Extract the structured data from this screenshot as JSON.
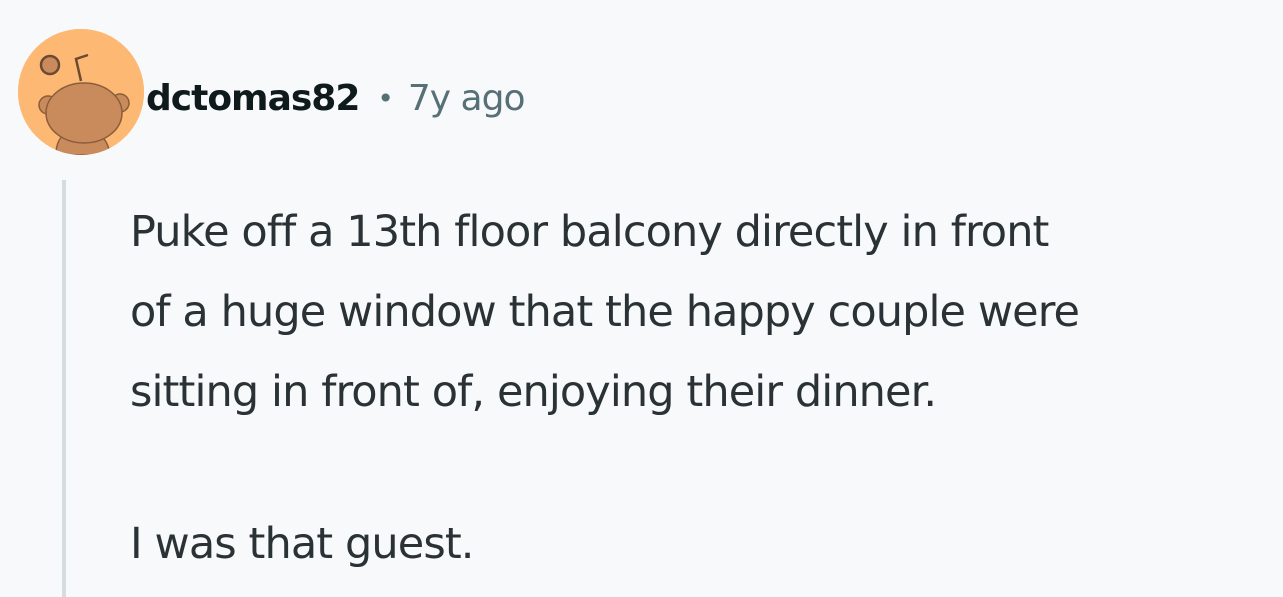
{
  "comment": {
    "author": "dctomas82",
    "separator": "•",
    "time": "7y ago",
    "body_lines": [
      "Puke off a 13th floor balcony directly in front",
      "of a huge window that the happy couple were",
      "sitting in front of, enjoying their dinner."
    ],
    "body_paragraph_2": "I was that guest.",
    "avatar_icon": "snoo-avatar-icon",
    "colors": {
      "avatar_bg": "#fdb974",
      "avatar_figure": "#c98b5c",
      "background": "#f7f9fa",
      "thread_line": "#d6dde1"
    }
  }
}
